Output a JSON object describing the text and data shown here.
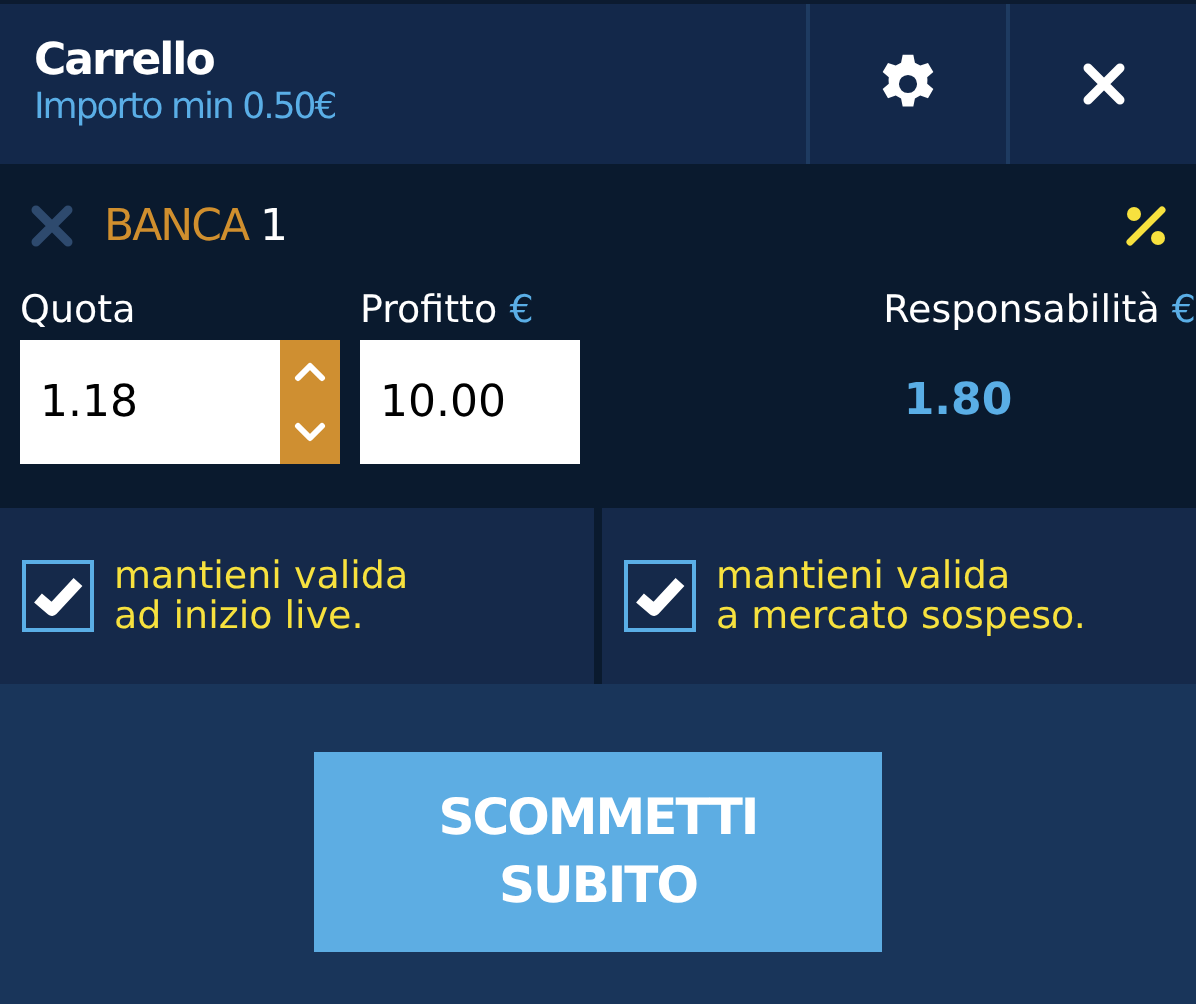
{
  "header": {
    "title": "Carrello",
    "subtitle": "Importo min 0.50€"
  },
  "bet": {
    "type": "BANCA",
    "number": "1"
  },
  "fields": {
    "odds_label": "Quota",
    "odds_value": "1.18",
    "profit_label": "Profitto",
    "profit_value": "10.00",
    "profit_currency": "€",
    "liability_label": "Responsabilità",
    "liability_currency": "€",
    "liability_value": "1.80"
  },
  "options": [
    {
      "label": "mantieni valida\nad inizio live.",
      "checked": true
    },
    {
      "label": "mantieni valida\na mercato sospeso.",
      "checked": true
    }
  ],
  "submit": "SCOMMETTI\nSUBITO"
}
